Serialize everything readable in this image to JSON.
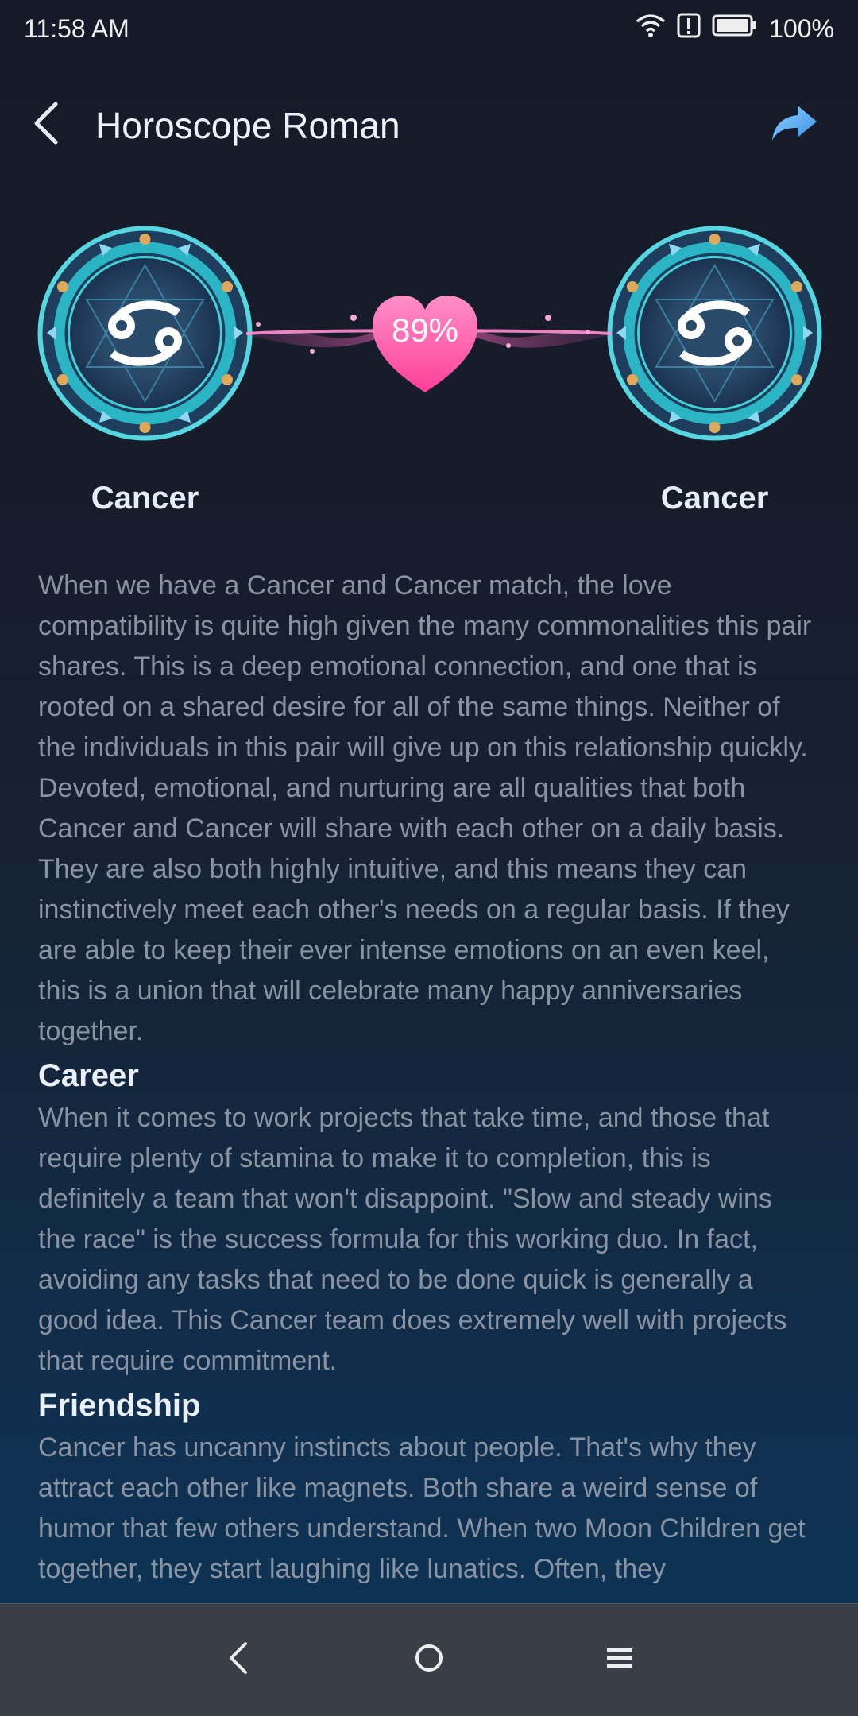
{
  "status": {
    "time": "11:58 AM",
    "battery": "100%",
    "icons": [
      "wifi-icon",
      "alert-icon",
      "battery-icon"
    ]
  },
  "header": {
    "title": "Horoscope Roman",
    "back_icon": "chevron-left-icon",
    "share_icon": "share-arrow-icon"
  },
  "match": {
    "left_sign": "Cancer",
    "right_sign": "Cancer",
    "percent": "89%",
    "accent_pink": "#ff5fa8",
    "ring_teal": "#37c9d4"
  },
  "article": {
    "intro": "When we have a Cancer and Cancer match, the love compatibility is quite high given the many commonalities this pair shares. This is a deep emotional connection, and one that is rooted on a shared desire for all of the same things. Neither of the individuals in this pair will give up on this relationship quickly. Devoted, emotional, and nurturing are all qualities that both Cancer and Cancer will share with each other on a daily basis. They are also both highly intuitive, and this means they can instinctively meet each other's needs on a regular basis. If they are able to keep their ever intense emotions on an even keel, this is a union that will celebrate many happy anniversaries together.",
    "career_title": "Career",
    "career_text": "When it comes to work projects that take time, and those that require plenty of stamina to make it to completion, this is definitely a team that won't disappoint. \"Slow and steady wins the race\" is the success formula for this working duo. In fact, avoiding any tasks that need to be done quick is generally a good idea. This Cancer team does extremely well with projects that require commitment.",
    "friendship_title": "Friendship",
    "friendship_text": "Cancer has uncanny instincts about people. That's why they attract each other like magnets. Both share a weird sense of humor that few others understand. When two Moon Children get together, they start laughing like lunatics. Often, they"
  },
  "navbar": {
    "back_icon": "nav-back-icon",
    "home_icon": "nav-home-icon",
    "menu_icon": "nav-menu-icon"
  }
}
